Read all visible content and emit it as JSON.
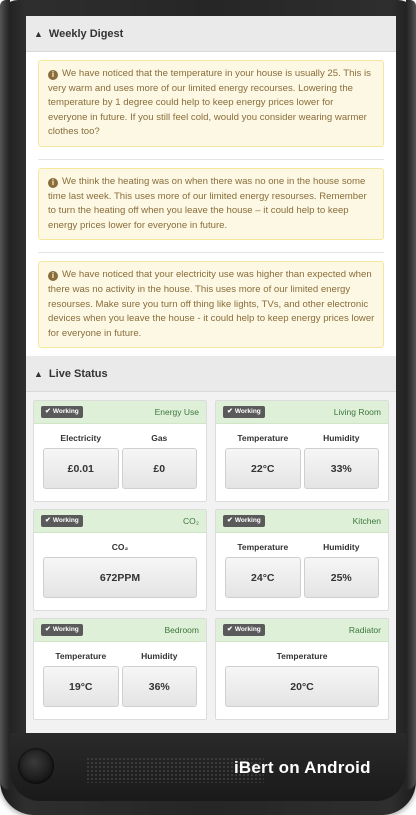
{
  "weekly_digest": {
    "title": "Weekly Digest",
    "messages": [
      "We have noticed that the temperature in your house is usually 25. This is very warm and uses more of our limited energy recourses. Lowering the temperature by 1 degree could help to keep energy prices lower for everyone in future. If you still feel cold, would you consider wearing warmer clothes too?",
      "We think the heating was on when there was no one in the house some time last week. This uses more of our limited energy resourses. Remember to turn the heating off when you leave the house – it could help to keep energy prices lower for everyone in future.",
      "We have noticed that your electricity use was higher than expected when there was no activity in the house. This uses more of our limited energy resourses. Make sure you turn off thing like lights, TVs, and other electronic devices when you leave the house - it could help to keep energy prices lower for everyone in future."
    ]
  },
  "live_status": {
    "title": "Live Status",
    "status_label": "Working",
    "cards": [
      {
        "title": "Energy Use",
        "metrics": [
          {
            "label": "Electricity",
            "value": "£0.01"
          },
          {
            "label": "Gas",
            "value": "£0"
          }
        ]
      },
      {
        "title": "Living Room",
        "metrics": [
          {
            "label": "Temperature",
            "value": "22°C"
          },
          {
            "label": "Humidity",
            "value": "33%"
          }
        ]
      },
      {
        "title": "CO₂",
        "metrics": [
          {
            "label": "CO₂",
            "value": "672PPM"
          }
        ]
      },
      {
        "title": "Kitchen",
        "metrics": [
          {
            "label": "Temperature",
            "value": "24°C"
          },
          {
            "label": "Humidity",
            "value": "25%"
          }
        ]
      },
      {
        "title": "Bedroom",
        "metrics": [
          {
            "label": "Temperature",
            "value": "19°C"
          },
          {
            "label": "Humidity",
            "value": "36%"
          }
        ]
      },
      {
        "title": "Radiator",
        "metrics": [
          {
            "label": "Temperature",
            "value": "20°C"
          }
        ]
      }
    ]
  },
  "device_caption": "iBert on Android",
  "icons": {
    "collapse": "chevron-up-icon",
    "info": "info-circle-icon",
    "check": "check-icon"
  },
  "colors": {
    "alert_bg": "#fcf8e3",
    "alert_text": "#8a6d3b",
    "card_header_bg": "#dff0d8",
    "card_title": "#3c763d",
    "badge_bg": "#5a5a5a"
  }
}
